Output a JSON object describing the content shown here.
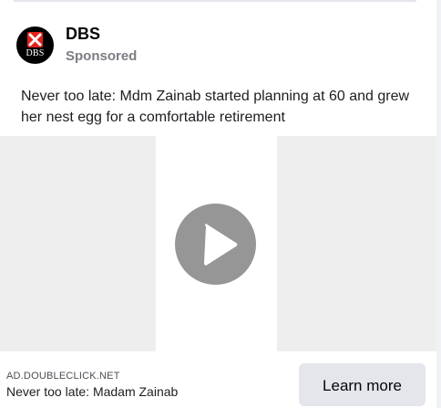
{
  "advertiser": {
    "name": "DBS",
    "logo_text": "DBS",
    "sponsored_label": "Sponsored"
  },
  "post": {
    "text": "Never too late: Mdm Zainab started planning at 60 and grew her nest egg for a comfortable retirement"
  },
  "media": {
    "type": "video",
    "icon": "play-icon"
  },
  "footer": {
    "domain": "AD.DOUBLECLICK.NET",
    "link_title": "Never too late: Madam Zainab",
    "cta_label": "Learn more"
  },
  "colors": {
    "logo_red": "#e2231a",
    "logo_background": "#000000",
    "cta_background": "#e4e6eb"
  }
}
